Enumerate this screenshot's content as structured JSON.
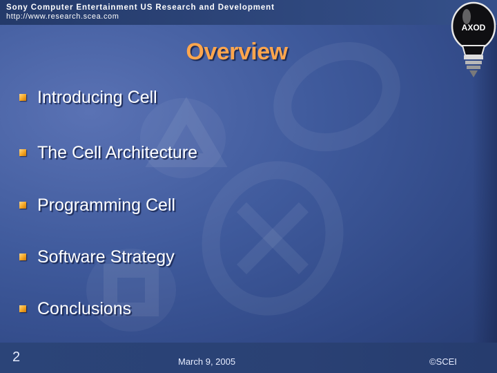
{
  "header": {
    "organization": "Sony Computer Entertainment US Research and Development",
    "url": "http://www.research.scea.com"
  },
  "logo": {
    "text": "AXOD",
    "icon": "lightbulb-icon"
  },
  "slide": {
    "title": "Overview",
    "bullets": [
      "Introducing Cell",
      "The Cell Architecture",
      "Programming Cell",
      "Software Strategy",
      "Conclusions"
    ]
  },
  "footer": {
    "page_number": "2",
    "date": "March 9, 2005",
    "copyright": "©SCEI"
  },
  "colors": {
    "title": "#ffa64d",
    "bullet": "#f5a623",
    "background": "#3f5a9c",
    "text": "#ffffff"
  }
}
